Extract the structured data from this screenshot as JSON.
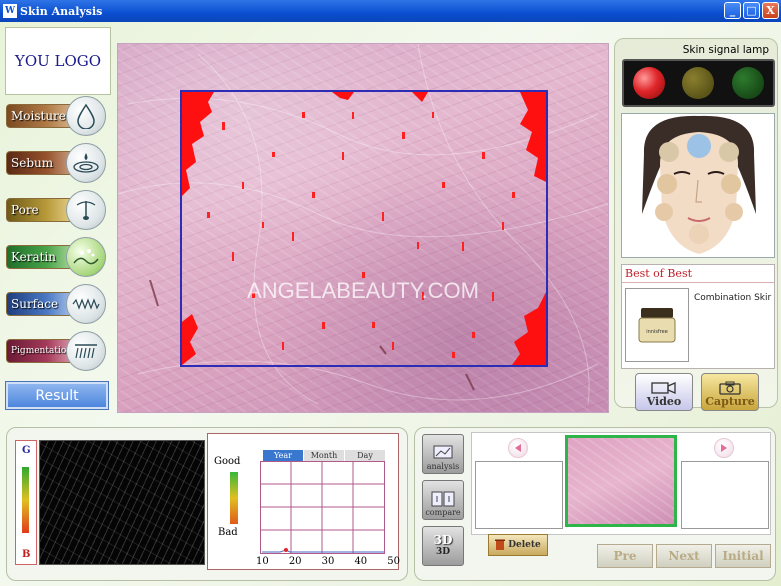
{
  "window": {
    "title": "Skin Analysis",
    "icon_text": "W",
    "buttons": [
      "_",
      "□",
      "X"
    ]
  },
  "logo": {
    "text": "YOU LOGO"
  },
  "nav": [
    {
      "label": "Moisture",
      "color": "#9a6a3c",
      "icon": "drop-icon"
    },
    {
      "label": "Sebum",
      "color": "#8a4a2a",
      "icon": "oil-ripple-icon"
    },
    {
      "label": "Pore",
      "color": "#b8902c",
      "icon": "hair-follicle-icon"
    },
    {
      "label": "Keratin",
      "color": "#4aa04a",
      "icon": "keratin-icon"
    },
    {
      "label": "Surface",
      "color": "#3a68b8",
      "icon": "wave-surface-icon"
    },
    {
      "label": "Pigmentation",
      "color": "#8a2a4a",
      "icon": "pigment-lines-icon"
    }
  ],
  "result_button": "Result",
  "watermark": "ANGELABEAUTY.COM",
  "skin_lamp": {
    "title": "Skin signal lamp",
    "lamps": [
      {
        "name": "red",
        "color": "#e0262a",
        "on": true
      },
      {
        "name": "yellow",
        "color": "#6a601e",
        "on": false
      },
      {
        "name": "green",
        "color": "#1f5b1f",
        "on": false
      }
    ]
  },
  "best": {
    "title": "Best of Best",
    "product_name": "Combination Skir",
    "product_label": "innisfree"
  },
  "camera_buttons": {
    "video": "Video",
    "capture": "Capture"
  },
  "scale": {
    "top": "G",
    "bottom": "B"
  },
  "graph": {
    "tabs": [
      "Year",
      "Month",
      "Day"
    ],
    "active_tab": "Year",
    "good": "Good",
    "bad": "Bad",
    "x_ticks": [
      "10",
      "20",
      "30",
      "40",
      "50"
    ]
  },
  "tools": [
    {
      "label": "analysis",
      "icon": "analysis-icon"
    },
    {
      "label": "compare",
      "icon": "compare-icon"
    },
    {
      "label": "3D",
      "icon_text": "3D",
      "icon": "3d-icon"
    }
  ],
  "delete_button": "Delete",
  "pager": [
    "Pre",
    "Next",
    "Initial"
  ]
}
